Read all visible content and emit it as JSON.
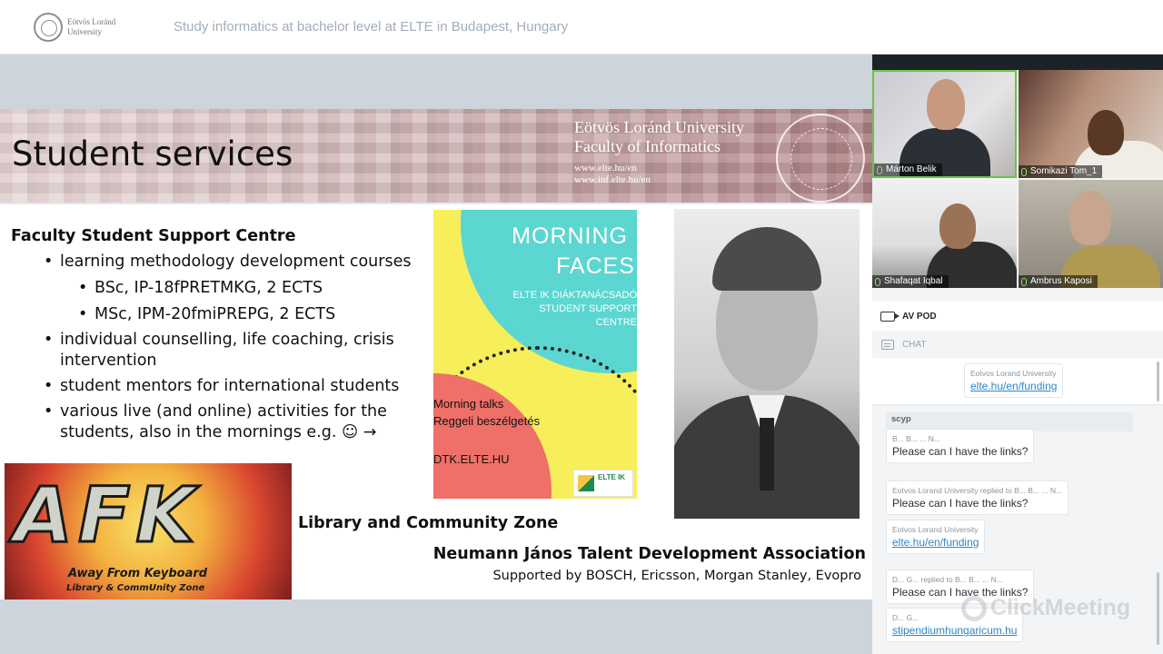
{
  "header": {
    "logo_line1": "Eötvös Loránd",
    "logo_line2": "University",
    "event_title": "Study informatics at bachelor level at ELTE in Budapest, Hungary"
  },
  "slide": {
    "title": "Student services",
    "university_name_line1": "Eötvös Loránd University",
    "university_name_line2": "Faculty of Informatics",
    "url1": "www.elte.hu/en",
    "url2": "www.inf.elte.hu/en",
    "heading": "Faculty Student Support Centre",
    "bullets": {
      "b1": "learning methodology development courses",
      "b1_sub1": "BSc, IP-18fPRETMKG, 2 ECTS",
      "b1_sub2": "MSc, IPM-20fmiPREPG, 2 ECTS",
      "b2": "individual counselling, life coaching, crisis intervention",
      "b3": "student mentors for international students",
      "b4": "various live (and online) activities for the students, also in the mornings e.g. ☺ →"
    },
    "poster": {
      "title1": "MORNING",
      "title2": "FACES",
      "subtitle": "ELTE IK DIÁKTANÁCSADÓ STUDENT SUPPORT CENTRE",
      "talk_line1": "Morning talks",
      "talk_line2": "Reggeli beszélgetés",
      "site": "DTK.ELTE.HU",
      "badge": "ELTE IK"
    },
    "afk": {
      "letters": "AFK",
      "sub1": "Away From Keyboard",
      "sub2": "Library & CommUnity Zone"
    },
    "library_label": "Library and Community Zone",
    "neumann_label": "Neumann János Talent Development Association",
    "supported_label": "Supported by BOSCH, Ericsson, Morgan Stanley, Evopro"
  },
  "video": {
    "participants": [
      {
        "name": "Márton Belik"
      },
      {
        "name": "Somikazi Tom_1"
      },
      {
        "name": "Shafaqat Iqbal"
      },
      {
        "name": "Ambrus Kaposi"
      }
    ]
  },
  "panel": {
    "avpod_label": "AV POD",
    "chat_label": "CHAT"
  },
  "chat": {
    "pinned": {
      "sender": "Eotvos Lorand University",
      "link": "elte.hu/en/funding"
    },
    "scyp": "scyp",
    "messages": [
      {
        "sender": "B... B... ... N...",
        "text": "Please can I have the links?"
      },
      {
        "sender": "Eotvos Lorand University replied to B... B... ... N...",
        "text": "Please can I have the links?"
      },
      {
        "sender": "Eotvos Lorand University",
        "link": "elte.hu/en/funding"
      },
      {
        "sender": "D... G... replied to B... B... ... N...",
        "text": "Please can I have the links?"
      },
      {
        "sender": "D... G...",
        "link": "stipendiumhungaricum.hu"
      }
    ]
  },
  "watermark": "ClickMeeting"
}
